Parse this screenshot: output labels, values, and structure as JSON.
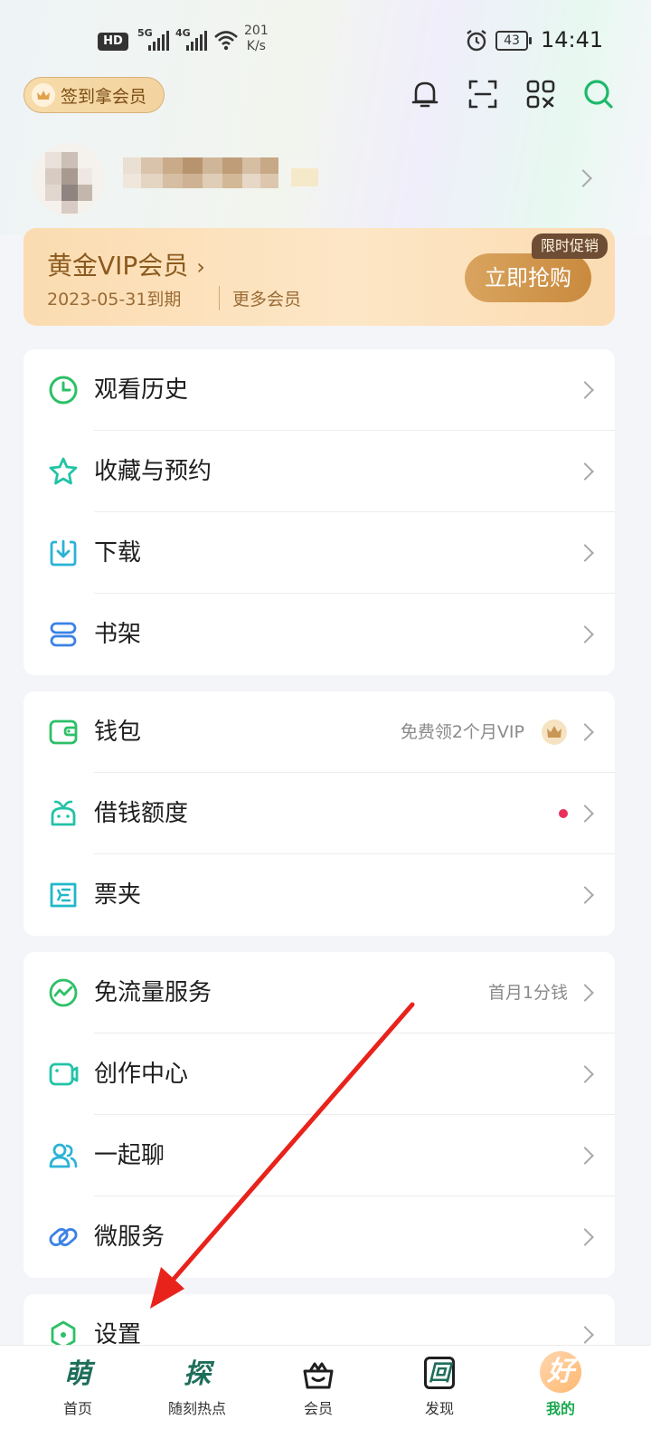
{
  "status_bar": {
    "hd": "HD",
    "net1": "5G",
    "net2": "4G",
    "speed_top": "201",
    "speed_bottom": "K/s",
    "battery": "43",
    "time": "14:41"
  },
  "header": {
    "checkin_label": "签到拿会员",
    "icons": [
      "bell-icon",
      "scan-icon",
      "qrcode-icon",
      "search-icon"
    ]
  },
  "vip": {
    "title": "黄金VIP会员",
    "expiry": "2023-05-31到期",
    "more": "更多会员",
    "promo_tag": "限时促销",
    "buy_label": "立即抢购"
  },
  "menu": {
    "group1": [
      {
        "label": "观看历史",
        "icon": "clock-icon"
      },
      {
        "label": "收藏与预约",
        "icon": "star-icon"
      },
      {
        "label": "下载",
        "icon": "download-icon"
      },
      {
        "label": "书架",
        "icon": "bookshelf-icon"
      }
    ],
    "group2": [
      {
        "label": "钱包",
        "icon": "wallet-icon",
        "extra": "免费领2个月VIP"
      },
      {
        "label": "借钱额度",
        "icon": "loan-icon"
      },
      {
        "label": "票夹",
        "icon": "ticket-icon"
      }
    ],
    "group3": [
      {
        "label": "免流量服务",
        "icon": "data-free-icon",
        "extra": "首月1分钱"
      },
      {
        "label": "创作中心",
        "icon": "camera-icon"
      },
      {
        "label": "一起聊",
        "icon": "people-icon"
      },
      {
        "label": "微服务",
        "icon": "link-icon"
      }
    ],
    "group4": [
      {
        "label": "设置",
        "icon": "settings-icon"
      }
    ]
  },
  "tabs": [
    {
      "label": "首页",
      "glyph": "萌"
    },
    {
      "label": "随刻热点",
      "glyph": "探"
    },
    {
      "label": "会员",
      "glyph": ""
    },
    {
      "label": "发现",
      "glyph": "回"
    },
    {
      "label": "我的",
      "glyph": "好"
    }
  ],
  "colors": {
    "accent_green": "#1fb96a",
    "tab_active": "#1aa84f",
    "vip_text": "#8b5a1f",
    "arrow_red": "#e8231c"
  }
}
